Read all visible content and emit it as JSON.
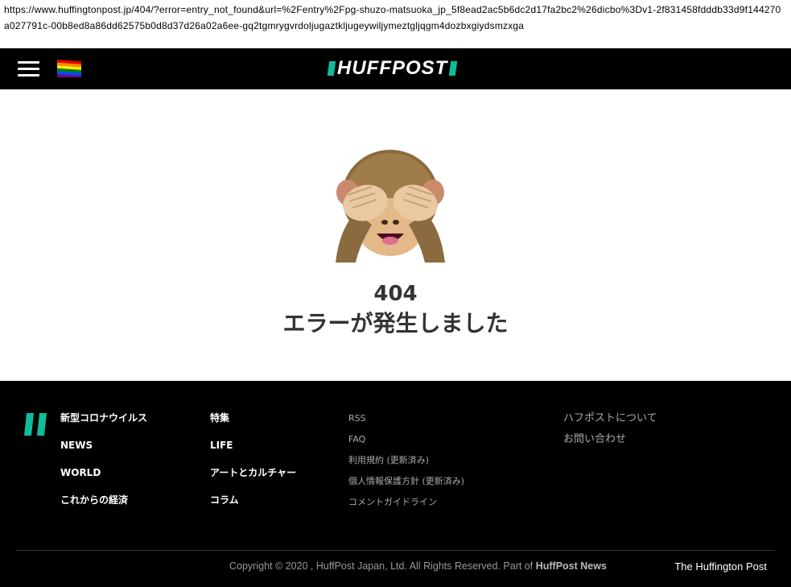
{
  "address_bar": {
    "url": "https://www.huffingtonpost.jp/404/?error=entry_not_found&url=%2Fentry%2Fpg-shuzo-matsuoka_jp_5f8ead2ac5b6dc2d17fa2bc2%26dicbo%3Dv1-2f831458fdddb33d9f144270a027791c-00b8ed8a86dd62575b0d8d37d26a02a6ee-gq2tgmrygvrdoljugaztkljugeywiljymeztgljqgm4dozbxgiydsmzxga"
  },
  "header": {
    "menu_icon": "hamburger-icon",
    "flag_icon": "rainbow-flag-icon",
    "logo_text": "HUFFPOST",
    "background": "#000000",
    "accent": "#0dbe98"
  },
  "error": {
    "icon": "see-no-evil-monkey",
    "code": "404",
    "message": "エラーが発生しました"
  },
  "footer": {
    "col1": [
      "新型コロナウイルス",
      "NEWS",
      "WORLD",
      "これからの経済"
    ],
    "col2": [
      "特集",
      "LIFE",
      "アートとカルチャー",
      "コラム"
    ],
    "col3": [
      "RSS",
      "FAQ",
      "利用規約 (更新済み)",
      "個人情報保護方針 (更新済み)",
      "コメントガイドライン"
    ],
    "col4": [
      "ハフポストについて",
      "お問い合わせ"
    ],
    "copyright_prefix": "Copyright © 2020 , HuffPost Japan, Ltd. All Rights Reserved. Part of",
    "copyright_brand": "HuffPost News",
    "huffington_link": "The Huffington Post"
  }
}
